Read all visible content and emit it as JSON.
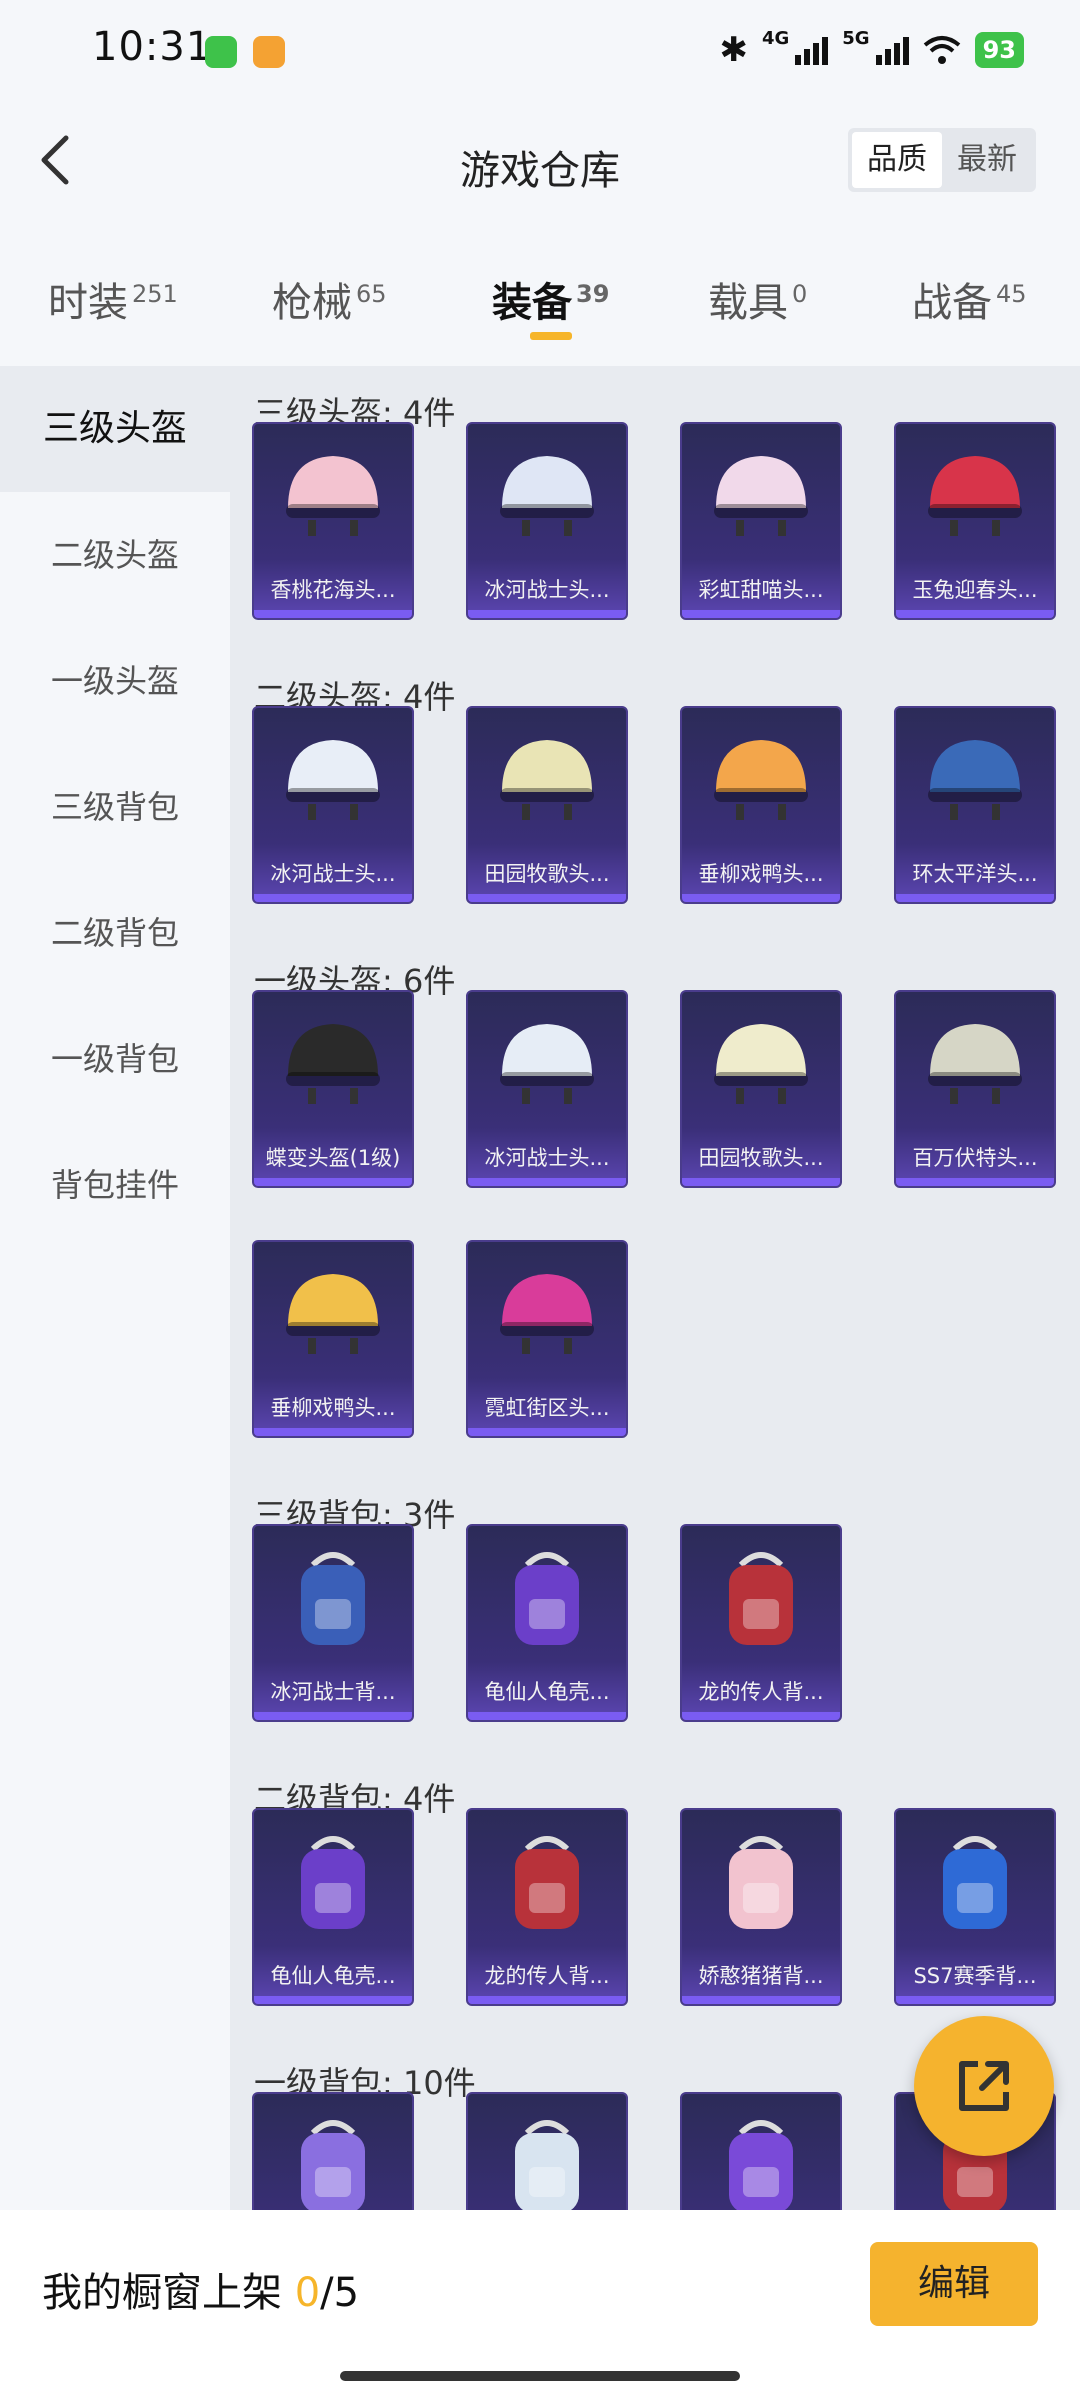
{
  "status": {
    "time": "10:31",
    "net_4g": "4G",
    "net_5g": "5G",
    "battery": "93"
  },
  "header": {
    "title": "游戏仓库",
    "sort_quality": "品质",
    "sort_latest": "最新"
  },
  "tabs": [
    {
      "label": "时装",
      "count": "251"
    },
    {
      "label": "枪械",
      "count": "65"
    },
    {
      "label": "装备",
      "count": "39"
    },
    {
      "label": "载具",
      "count": "0"
    },
    {
      "label": "战备",
      "count": "45"
    }
  ],
  "sidebar": [
    "三级头盔",
    "二级头盔",
    "一级头盔",
    "三级背包",
    "二级背包",
    "一级背包",
    "背包挂件"
  ],
  "sections": [
    {
      "title": "三级头盔: 4件",
      "items": [
        "香桃花海头...",
        "冰河战士头...",
        "彩虹甜喵头...",
        "玉兔迎春头..."
      ]
    },
    {
      "title": "二级头盔: 4件",
      "items": [
        "冰河战士头...",
        "田园牧歌头...",
        "垂柳戏鸭头...",
        "环太平洋头..."
      ]
    },
    {
      "title": "一级头盔: 6件",
      "items": [
        "蝶变头盔(1级)",
        "冰河战士头...",
        "田园牧歌头...",
        "百万伏特头...",
        "垂柳戏鸭头...",
        "霓虹街区头..."
      ]
    },
    {
      "title": "三级背包: 3件",
      "items": [
        "冰河战士背...",
        "龟仙人龟壳...",
        "龙的传人背..."
      ]
    },
    {
      "title": "二级背包: 4件",
      "items": [
        "龟仙人龟壳...",
        "龙的传人背...",
        "娇憨猪猪背...",
        "SS7赛季背..."
      ]
    },
    {
      "title": "一级背包: 10件",
      "items": [
        "",
        "",
        "",
        ""
      ]
    }
  ],
  "footer": {
    "label": "我的橱窗上架 ",
    "count": "0",
    "total": "/5",
    "edit": "编辑"
  },
  "colors": {
    "accent": "#f5b32e",
    "card": "#2f2d64"
  }
}
